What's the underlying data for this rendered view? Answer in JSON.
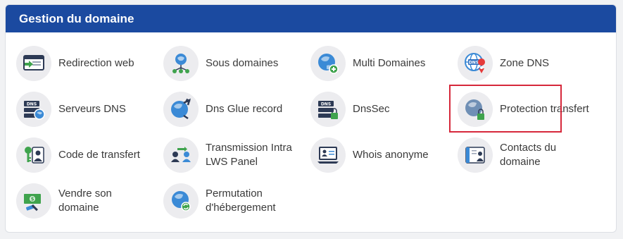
{
  "header": {
    "title": "Gestion du domaine"
  },
  "items": [
    {
      "label": "Redirection web",
      "icon": "redirect-icon"
    },
    {
      "label": "Sous domaines",
      "icon": "subdomain-icon"
    },
    {
      "label": "Multi Domaines",
      "icon": "multi-domain-icon"
    },
    {
      "label": "Zone DNS",
      "icon": "dns-zone-icon"
    },
    {
      "label": "Serveurs DNS",
      "icon": "dns-server-icon"
    },
    {
      "label": "Dns Glue record",
      "icon": "glue-record-icon"
    },
    {
      "label": "DnsSec",
      "icon": "dnssec-icon"
    },
    {
      "label": "Protection transfert",
      "icon": "transfer-protection-icon"
    },
    {
      "label": "Code de transfert",
      "icon": "transfer-code-icon"
    },
    {
      "label": "Transmission Intra LWS Panel",
      "icon": "transmission-icon"
    },
    {
      "label": "Whois anonyme",
      "icon": "whois-icon"
    },
    {
      "label": "Contacts du domaine",
      "icon": "contacts-icon"
    },
    {
      "label": "Vendre son domaine",
      "icon": "sell-domain-icon"
    },
    {
      "label": "Permutation d'hébergement",
      "icon": "hosting-swap-icon"
    }
  ],
  "highlighted_item": "Protection transfert",
  "colors": {
    "header": "#1b4aa0",
    "highlight": "#d6283b",
    "globe": "#3b8ad6",
    "green": "#3fa34d"
  }
}
